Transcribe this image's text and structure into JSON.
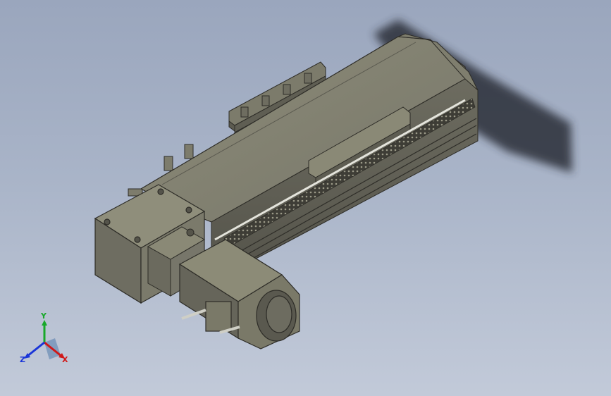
{
  "viewport": {
    "background_top": "#9aa6bd",
    "background_bottom": "#c2cad9",
    "model_color": "#85846f",
    "shadow_color": "#2c2f38"
  },
  "triad": {
    "x_label": "X",
    "y_label": "Y",
    "z_label": "Z",
    "x_color": "#d01818",
    "y_color": "#18a82a",
    "z_color": "#1a35d8"
  }
}
